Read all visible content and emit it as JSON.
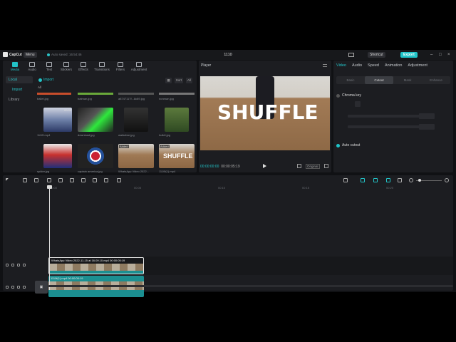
{
  "app": {
    "name": "CapCut",
    "menu_label": "Menu",
    "autosave": "Auto saved: 16:54:46",
    "project_title": "1110",
    "shortcut_label": "Shortcut",
    "export_label": "Export",
    "accent_color": "#20c5c9"
  },
  "toolbar": {
    "items": [
      {
        "label": "Media",
        "icon": "media-icon"
      },
      {
        "label": "Audio",
        "icon": "audio-icon"
      },
      {
        "label": "Text",
        "icon": "text-icon"
      },
      {
        "label": "Stickers",
        "icon": "stickers-icon"
      },
      {
        "label": "Effects",
        "icon": "effects-icon"
      },
      {
        "label": "Transitions",
        "icon": "transitions-icon"
      },
      {
        "label": "Filters",
        "icon": "filters-icon"
      },
      {
        "label": "Adjustment",
        "icon": "adjustment-icon"
      }
    ]
  },
  "media": {
    "sidebar": {
      "local": "Local",
      "import": "Import",
      "library": "Library"
    },
    "import_label": "Import",
    "sort_label": "Sort",
    "all_filter": "All",
    "all_label": "All",
    "items": [
      {
        "name": "1110f.mp4",
        "duration": "00:05",
        "added": ""
      },
      {
        "name": "download.jpg",
        "duration": "",
        "added": ""
      },
      {
        "name": "wafadme.jpg",
        "duration": "",
        "added": ""
      },
      {
        "name": "hulk6.jpg",
        "duration": "",
        "added": ""
      },
      {
        "name": "spider.jpg",
        "duration": "",
        "added": ""
      },
      {
        "name": "captain america.jpg",
        "duration": "",
        "added": ""
      },
      {
        "name": "WhatsApp Video 2022...",
        "duration": "",
        "added": "Added"
      },
      {
        "name": "1110f(1).mp4",
        "duration": "",
        "added": "Added"
      }
    ],
    "top_names": [
      "ballet.jpg",
      "batman.jpg",
      "a8747117f...8c89.jpg",
      "ironman.jpg"
    ]
  },
  "player": {
    "title": "Player",
    "overlay_text": "SHUFFLE",
    "current_time": "00:00:00:00",
    "total_time": "00:00:05:19",
    "original_label": "Original"
  },
  "inspector": {
    "tabs": [
      "Video",
      "Audio",
      "Speed",
      "Animation",
      "Adjustment"
    ],
    "sub_tabs": [
      "Basic",
      "Cutout",
      "Mask",
      "Enhance"
    ],
    "chroma_key": "Chroma key",
    "auto_cutout": "Auto cutout"
  },
  "timeline": {
    "ruler": [
      "00:00",
      "00:05",
      "00:10",
      "00:15",
      "00:20"
    ],
    "clip1_label": "WhatsApp Video 2022-11-15 at 16.09.10.mp4   00:00:05:19",
    "clip2_label": "1110f(1).mp4   00:00:05:19",
    "cover_label": "Cover"
  }
}
